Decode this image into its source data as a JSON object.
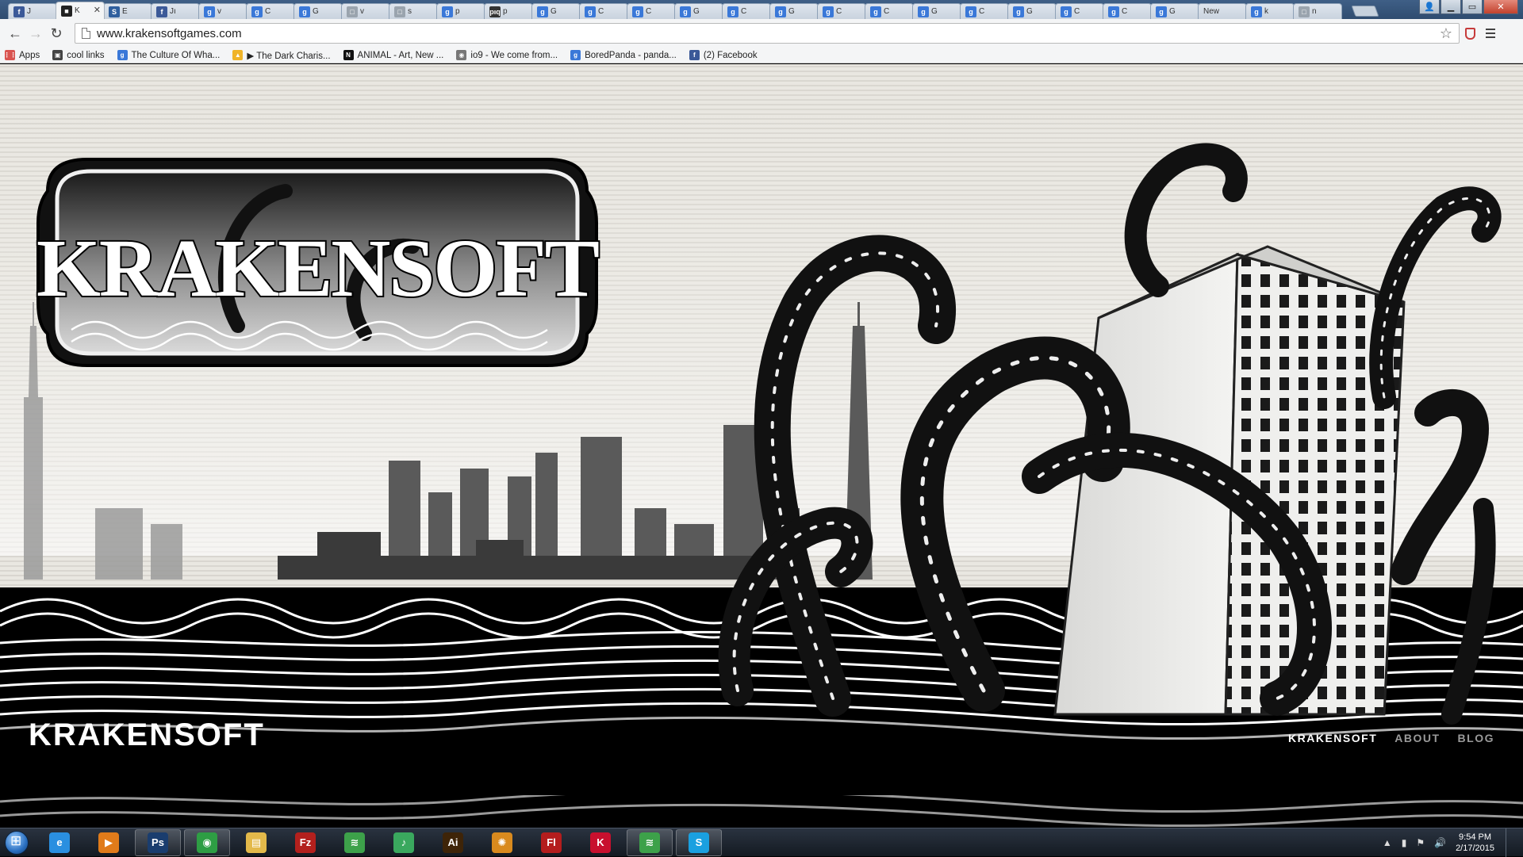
{
  "browser": {
    "tabs": [
      {
        "label": "J",
        "fav": "f",
        "color": "#3b5998"
      },
      {
        "label": "K",
        "fav": "■",
        "color": "#222222",
        "active": true,
        "close": "✕"
      },
      {
        "label": "E",
        "fav": "S",
        "color": "#2f5f9e"
      },
      {
        "label": "Jı",
        "fav": "f",
        "color": "#3b5998"
      },
      {
        "label": "v",
        "fav": "g",
        "color": "#3a78d8"
      },
      {
        "label": "C",
        "fav": "g",
        "color": "#3a78d8"
      },
      {
        "label": "G",
        "fav": "g",
        "color": "#3a78d8"
      },
      {
        "label": "v",
        "fav": "□",
        "color": "#9aa4ae"
      },
      {
        "label": "s",
        "fav": "□",
        "color": "#9aa4ae"
      },
      {
        "label": "p",
        "fav": "g",
        "color": "#3a78d8"
      },
      {
        "label": "p",
        "fav": "pıq",
        "color": "#333333"
      },
      {
        "label": "G",
        "fav": "g",
        "color": "#3a78d8"
      },
      {
        "label": "C",
        "fav": "g",
        "color": "#3a78d8"
      },
      {
        "label": "C",
        "fav": "g",
        "color": "#3a78d8"
      },
      {
        "label": "G",
        "fav": "g",
        "color": "#3a78d8"
      },
      {
        "label": "C",
        "fav": "g",
        "color": "#3a78d8"
      },
      {
        "label": "G",
        "fav": "g",
        "color": "#3a78d8"
      },
      {
        "label": "C",
        "fav": "g",
        "color": "#3a78d8"
      },
      {
        "label": "C",
        "fav": "g",
        "color": "#3a78d8"
      },
      {
        "label": "G",
        "fav": "g",
        "color": "#3a78d8"
      },
      {
        "label": "C",
        "fav": "g",
        "color": "#3a78d8"
      },
      {
        "label": "G",
        "fav": "g",
        "color": "#3a78d8"
      },
      {
        "label": "C",
        "fav": "g",
        "color": "#3a78d8"
      },
      {
        "label": "C",
        "fav": "g",
        "color": "#3a78d8"
      },
      {
        "label": "G",
        "fav": "g",
        "color": "#3a78d8"
      },
      {
        "label": "New",
        "fav": "",
        "color": "#cccccc"
      },
      {
        "label": "k",
        "fav": "g",
        "color": "#3a78d8"
      },
      {
        "label": "n",
        "fav": "□",
        "color": "#9aa4ae"
      }
    ],
    "url": "www.krakensoftgames.com",
    "back": "←",
    "forward": "→",
    "reload": "↻",
    "star": "☆",
    "min": "▁",
    "max": "▭",
    "close": "✕",
    "user": "👤"
  },
  "bookmarks": [
    {
      "label": "Apps",
      "icon": "⋮⋮",
      "color": "#d9534f"
    },
    {
      "label": "cool links",
      "icon": "▣",
      "color": "#444444"
    },
    {
      "label": "The Culture Of Wha...",
      "icon": "g",
      "color": "#3a78d8"
    },
    {
      "label": "▶ The Dark Charis...",
      "icon": "▲",
      "color": "#f0b429"
    },
    {
      "label": "ANIMAL - Art, New ...",
      "icon": "N",
      "color": "#111111"
    },
    {
      "label": "io9 - We come from...",
      "icon": "◉",
      "color": "#777777"
    },
    {
      "label": "BoredPanda - panda...",
      "icon": "g",
      "color": "#3a78d8"
    },
    {
      "label": "(2) Facebook",
      "icon": "f",
      "color": "#3b5998"
    }
  ],
  "site": {
    "logo_text": "KRAKENSOFT",
    "title": "KRAKENSOFT",
    "nav": [
      "KRAKENSOFT",
      "ABOUT",
      "BLOG"
    ]
  },
  "taskbar": {
    "apps": [
      {
        "name": "internet-explorer",
        "glyph": "e",
        "color": "#2a8fe0",
        "running": false
      },
      {
        "name": "media-player",
        "glyph": "▶",
        "color": "#e07b1a",
        "running": false
      },
      {
        "name": "photoshop",
        "glyph": "Ps",
        "color": "#1a3d6e",
        "running": true
      },
      {
        "name": "chrome",
        "glyph": "◉",
        "color": "#2e9e44",
        "running": true
      },
      {
        "name": "explorer",
        "glyph": "▤",
        "color": "#e3b94a",
        "running": false
      },
      {
        "name": "filezilla",
        "glyph": "Fz",
        "color": "#b3201d",
        "running": false
      },
      {
        "name": "spotify",
        "glyph": "≋",
        "color": "#3da14a",
        "running": false
      },
      {
        "name": "itunes",
        "glyph": "♪",
        "color": "#3aa85e",
        "running": false
      },
      {
        "name": "illustrator",
        "glyph": "Ai",
        "color": "#3e2408",
        "running": false
      },
      {
        "name": "photo-app",
        "glyph": "✺",
        "color": "#d98a1e",
        "running": false
      },
      {
        "name": "flash",
        "glyph": "Fl",
        "color": "#b41d1d",
        "running": false
      },
      {
        "name": "kaspersky",
        "glyph": "K",
        "color": "#c8102e",
        "running": false
      },
      {
        "name": "spotify-running",
        "glyph": "≋",
        "color": "#3da14a",
        "running": true
      },
      {
        "name": "skype",
        "glyph": "S",
        "color": "#1aa0e0",
        "running": true
      }
    ],
    "time": "9:54 PM",
    "date": "2/17/2015",
    "tray_arrow": "▲",
    "tray_signal": "▮",
    "tray_flag": "⚑",
    "tray_volume": "🔊"
  }
}
